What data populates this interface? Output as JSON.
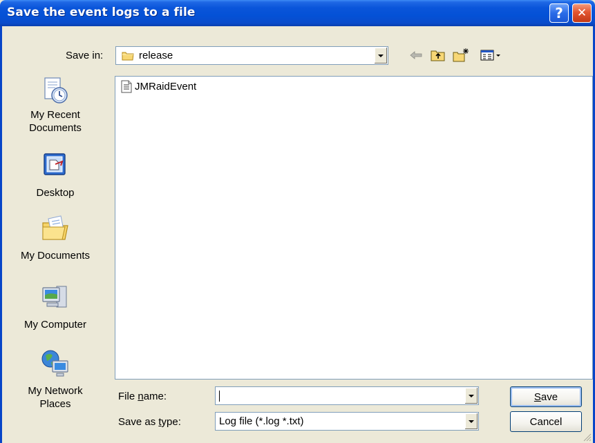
{
  "window": {
    "title": "Save the event logs to a file",
    "help_glyph": "?",
    "close_glyph": "✕"
  },
  "save_in": {
    "label": "Save in:",
    "value": "release"
  },
  "places": [
    {
      "label": "My Recent Documents",
      "line1": "My Recent",
      "line2": "Documents",
      "icon": "recent-documents-icon"
    },
    {
      "label": "Desktop",
      "line1": "Desktop",
      "line2": "",
      "icon": "desktop-icon"
    },
    {
      "label": "My Documents",
      "line1": "My Documents",
      "line2": "",
      "icon": "my-documents-icon"
    },
    {
      "label": "My Computer",
      "line1": "My Computer",
      "line2": "",
      "icon": "my-computer-icon"
    },
    {
      "label": "My Network Places",
      "line1": "My Network",
      "line2": "Places",
      "icon": "network-places-icon"
    }
  ],
  "files": [
    {
      "name": "JMRaidEvent",
      "icon": "text-file-icon"
    }
  ],
  "file_name": {
    "label_pre": "File ",
    "label_ul": "n",
    "label_post": "ame:",
    "value": ""
  },
  "save_as_type": {
    "label_pre": "Save as ",
    "label_ul": "t",
    "label_post": "ype:",
    "value": "Log file (*.log *.txt)"
  },
  "buttons": {
    "save_ul": "S",
    "save_rest": "ave",
    "cancel": "Cancel"
  },
  "colors": {
    "titlebar": "#0A55DA",
    "dialog_bg": "#ECE9D8",
    "close_button": "#E25530"
  }
}
